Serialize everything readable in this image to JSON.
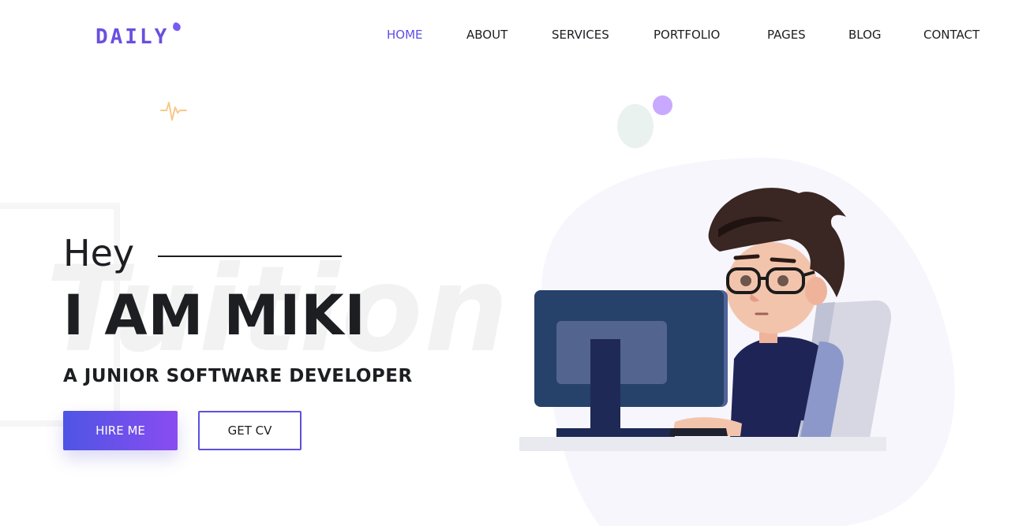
{
  "header": {
    "logo_text": "DAILY",
    "nav": [
      {
        "label": "HOME",
        "active": true
      },
      {
        "label": "ABOUT",
        "active": false
      },
      {
        "label": "SERVICES",
        "active": false
      },
      {
        "label": "PORTFOLIO",
        "active": false
      },
      {
        "label": "PAGES",
        "active": false
      },
      {
        "label": "BLOG",
        "active": false
      },
      {
        "label": "CONTACT",
        "active": false
      }
    ]
  },
  "hero": {
    "background_word": "Tuition",
    "greeting": "Hey",
    "name": "I AM MIKI",
    "role": "A JUNIOR SOFTWARE DEVELOPER",
    "hire_button": "HIRE ME",
    "cv_button": "GET CV"
  },
  "colors": {
    "accent": "#5b4ee6",
    "gradient_start": "#4e55e4",
    "gradient_end": "#8a4cf0",
    "text": "#1d1e22"
  },
  "icons": {
    "pulse": "pulse-line-icon"
  }
}
